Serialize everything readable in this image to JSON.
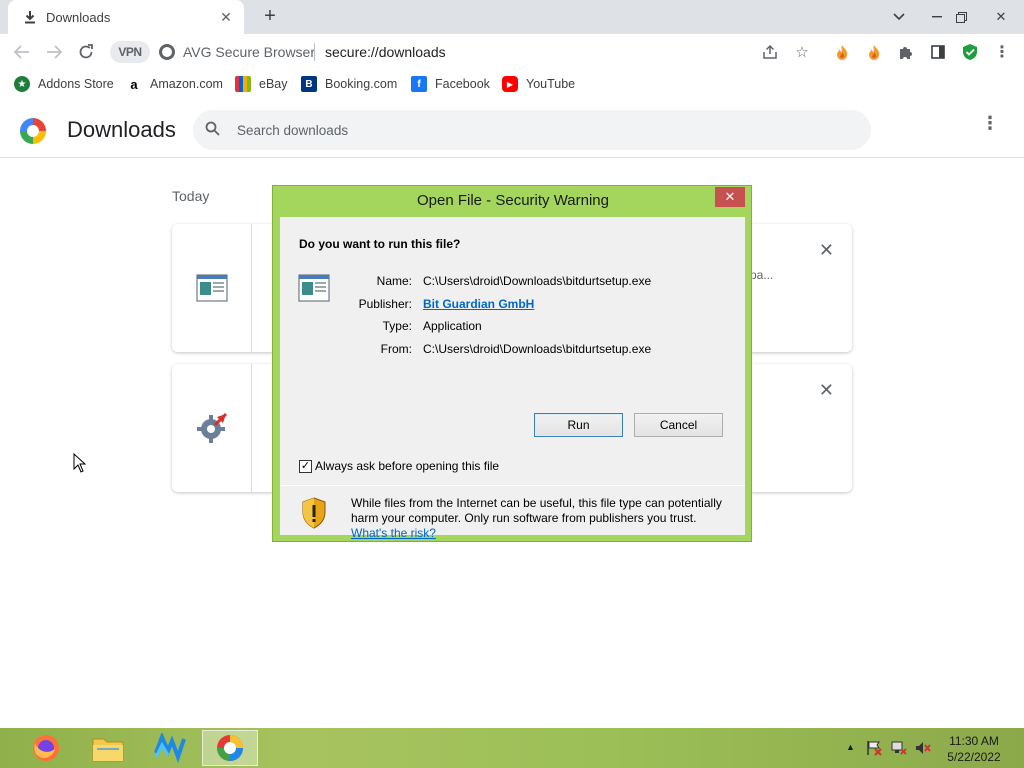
{
  "browser": {
    "tab_title": "Downloads",
    "vpn_label": "VPN",
    "browser_name": "AVG Secure Browser",
    "url": "secure://downloads"
  },
  "bookmarks": [
    {
      "label": "Addons Store"
    },
    {
      "label": "Amazon.com"
    },
    {
      "label": "eBay"
    },
    {
      "label": "Booking.com"
    },
    {
      "label": "Facebook"
    },
    {
      "label": "YouTube"
    }
  ],
  "downloads_page": {
    "title": "Downloads",
    "search_placeholder": "Search downloads",
    "section_label": "Today",
    "card1_trailing_text": "pa..."
  },
  "dialog": {
    "title": "Open File - Security Warning",
    "question": "Do you want to run this file?",
    "fields": [
      {
        "label": "Name:",
        "value": "C:\\Users\\droid\\Downloads\\bitdurtsetup.exe"
      },
      {
        "label": "Publisher:",
        "value": "Bit Guardian GmbH"
      },
      {
        "label": "Type:",
        "value": "Application"
      },
      {
        "label": "From:",
        "value": "C:\\Users\\droid\\Downloads\\bitdurtsetup.exe"
      }
    ],
    "run_label": "Run",
    "cancel_label": "Cancel",
    "checkbox_label": "Always ask before opening this file",
    "checkbox_checked": true,
    "warning_text": "While files from the Internet can be useful, this file type can potentially harm your computer. Only run software from publishers you trust.",
    "risk_link": "What's the risk?"
  },
  "taskbar": {
    "time": "11:30 AM",
    "date": "5/22/2022"
  },
  "colors": {
    "dialog_frame": "#a4d65e",
    "link": "#0066cc",
    "close_red": "#c75050"
  }
}
